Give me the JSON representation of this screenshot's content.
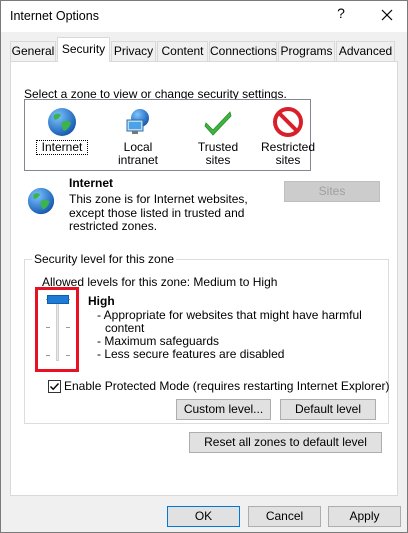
{
  "window": {
    "title": "Internet Options",
    "help_glyph": "?",
    "close_icon": "close-icon"
  },
  "tabs": [
    {
      "label": "General"
    },
    {
      "label": "Security",
      "active": true
    },
    {
      "label": "Privacy"
    },
    {
      "label": "Content"
    },
    {
      "label": "Connections"
    },
    {
      "label": "Programs"
    },
    {
      "label": "Advanced"
    }
  ],
  "security": {
    "zone_prompt": "Select a zone to view or change security settings.",
    "zones": [
      {
        "label": "Internet",
        "icon": "globe-icon",
        "selected": true
      },
      {
        "label": "Local intranet",
        "icon": "intranet-icon"
      },
      {
        "label": "Trusted sites",
        "icon": "checkmark-icon"
      },
      {
        "label": "Restricted sites",
        "label_line1": "Restricted",
        "label_line2": "sites",
        "icon": "restricted-icon"
      }
    ],
    "zone_title": "Internet",
    "zone_desc_line1": "This zone is for Internet websites,",
    "zone_desc_line2": "except those listed in trusted and",
    "zone_desc_line3": "restricted zones.",
    "sites_button": "Sites",
    "security_level_legend": "Security level for this zone",
    "allowed_levels": "Allowed levels for this zone: Medium to High",
    "level_name": "High",
    "level_desc": [
      "- Appropriate for websites that might have harmful",
      "  content",
      "- Maximum safeguards",
      "- Less secure features are disabled"
    ],
    "slider_level": "High",
    "protected_mode_label": "Enable Protected Mode (requires restarting Internet Explorer)",
    "protected_mode_checked": true,
    "custom_level_button": "Custom level...",
    "default_level_button": "Default level",
    "reset_all_button": "Reset all zones to default level"
  },
  "footer": {
    "ok": "OK",
    "cancel": "Cancel",
    "apply": "Apply"
  },
  "colors": {
    "slider_thumb": "#1e7bd7",
    "highlight_box": "#e81123",
    "accent": "#0078d7"
  }
}
